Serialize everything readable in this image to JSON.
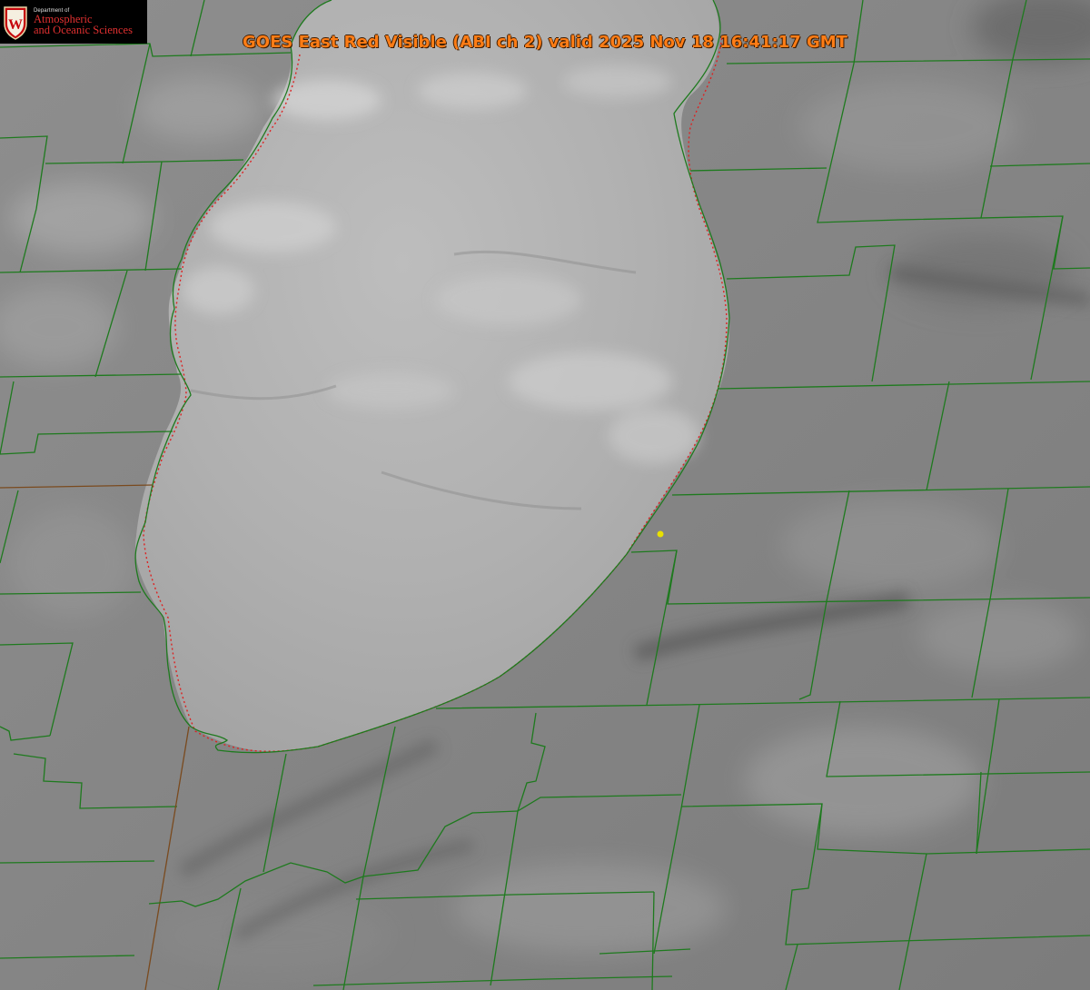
{
  "title": "GOES East Red Visible (ABI ch 2) valid 2025 Nov 18 16:41:17 GMT",
  "logo": {
    "department": "Department of",
    "line1": "Atmospheric",
    "line2": "and Oceanic Sciences",
    "crest_letter": "W",
    "crest_color": "#c5050c"
  },
  "colors": {
    "background": "#808080",
    "boundary": "#1e7a1e",
    "coastline_dotted": "#dd2222",
    "title": "#ff7d16",
    "marker": "#e8e000"
  },
  "map": {
    "satellite": "GOES East",
    "band": "Red Visible (ABI ch 2)",
    "overlay": "county boundaries",
    "marker_icon": "yellow-dot"
  }
}
